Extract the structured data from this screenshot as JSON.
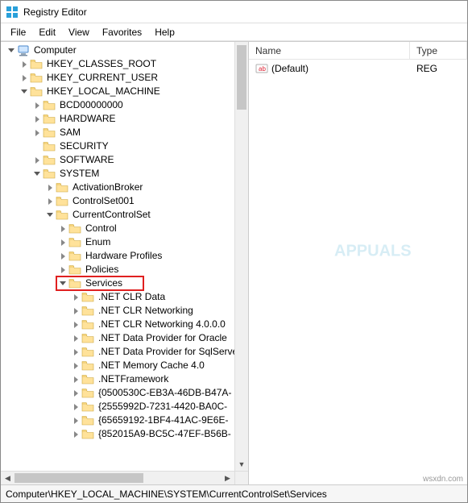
{
  "titlebar": {
    "title": "Registry Editor"
  },
  "menu": {
    "file": "File",
    "edit": "Edit",
    "view": "View",
    "favorites": "Favorites",
    "help": "Help"
  },
  "tree": {
    "root": "Computer",
    "items": [
      {
        "depth": 0,
        "tw": "open",
        "icon": "computer",
        "label": "Computer"
      },
      {
        "depth": 1,
        "tw": "closed",
        "icon": "folder",
        "label": "HKEY_CLASSES_ROOT"
      },
      {
        "depth": 1,
        "tw": "closed",
        "icon": "folder",
        "label": "HKEY_CURRENT_USER"
      },
      {
        "depth": 1,
        "tw": "open",
        "icon": "folder",
        "label": "HKEY_LOCAL_MACHINE"
      },
      {
        "depth": 2,
        "tw": "closed",
        "icon": "folder",
        "label": "BCD00000000"
      },
      {
        "depth": 2,
        "tw": "closed",
        "icon": "folder",
        "label": "HARDWARE"
      },
      {
        "depth": 2,
        "tw": "closed",
        "icon": "folder",
        "label": "SAM"
      },
      {
        "depth": 2,
        "tw": "none",
        "icon": "folder",
        "label": "SECURITY"
      },
      {
        "depth": 2,
        "tw": "closed",
        "icon": "folder",
        "label": "SOFTWARE"
      },
      {
        "depth": 2,
        "tw": "open",
        "icon": "folder",
        "label": "SYSTEM"
      },
      {
        "depth": 3,
        "tw": "closed",
        "icon": "folder",
        "label": "ActivationBroker"
      },
      {
        "depth": 3,
        "tw": "closed",
        "icon": "folder",
        "label": "ControlSet001"
      },
      {
        "depth": 3,
        "tw": "open",
        "icon": "folder",
        "label": "CurrentControlSet"
      },
      {
        "depth": 4,
        "tw": "closed",
        "icon": "folder",
        "label": "Control"
      },
      {
        "depth": 4,
        "tw": "closed",
        "icon": "folder",
        "label": "Enum"
      },
      {
        "depth": 4,
        "tw": "closed",
        "icon": "folder",
        "label": "Hardware Profiles"
      },
      {
        "depth": 4,
        "tw": "closed",
        "icon": "folder",
        "label": "Policies"
      },
      {
        "depth": 4,
        "tw": "open",
        "icon": "folder",
        "label": "Services",
        "highlight": true
      },
      {
        "depth": 5,
        "tw": "closed",
        "icon": "folder",
        "label": ".NET CLR Data"
      },
      {
        "depth": 5,
        "tw": "closed",
        "icon": "folder",
        "label": ".NET CLR Networking"
      },
      {
        "depth": 5,
        "tw": "closed",
        "icon": "folder",
        "label": ".NET CLR Networking 4.0.0.0"
      },
      {
        "depth": 5,
        "tw": "closed",
        "icon": "folder",
        "label": ".NET Data Provider for Oracle"
      },
      {
        "depth": 5,
        "tw": "closed",
        "icon": "folder",
        "label": ".NET Data Provider for SqlServer"
      },
      {
        "depth": 5,
        "tw": "closed",
        "icon": "folder",
        "label": ".NET Memory Cache 4.0"
      },
      {
        "depth": 5,
        "tw": "closed",
        "icon": "folder",
        "label": ".NETFramework"
      },
      {
        "depth": 5,
        "tw": "closed",
        "icon": "folder",
        "label": "{0500530C-EB3A-46DB-B47A-"
      },
      {
        "depth": 5,
        "tw": "closed",
        "icon": "folder",
        "label": "{2555992D-7231-4420-BA0C-"
      },
      {
        "depth": 5,
        "tw": "closed",
        "icon": "folder",
        "label": "{65659192-1BF4-41AC-9E6E-"
      },
      {
        "depth": 5,
        "tw": "closed",
        "icon": "folder",
        "label": "{852015A9-BC5C-47EF-B56B-"
      }
    ]
  },
  "list": {
    "columns": {
      "name": "Name",
      "type": "Type"
    },
    "rows": [
      {
        "name": "(Default)",
        "type": "REG"
      }
    ]
  },
  "statusbar": {
    "path": "Computer\\HKEY_LOCAL_MACHINE\\SYSTEM\\CurrentControlSet\\Services"
  },
  "watermark": {
    "brand": "APPUALS",
    "site": "wsxdn.com"
  }
}
